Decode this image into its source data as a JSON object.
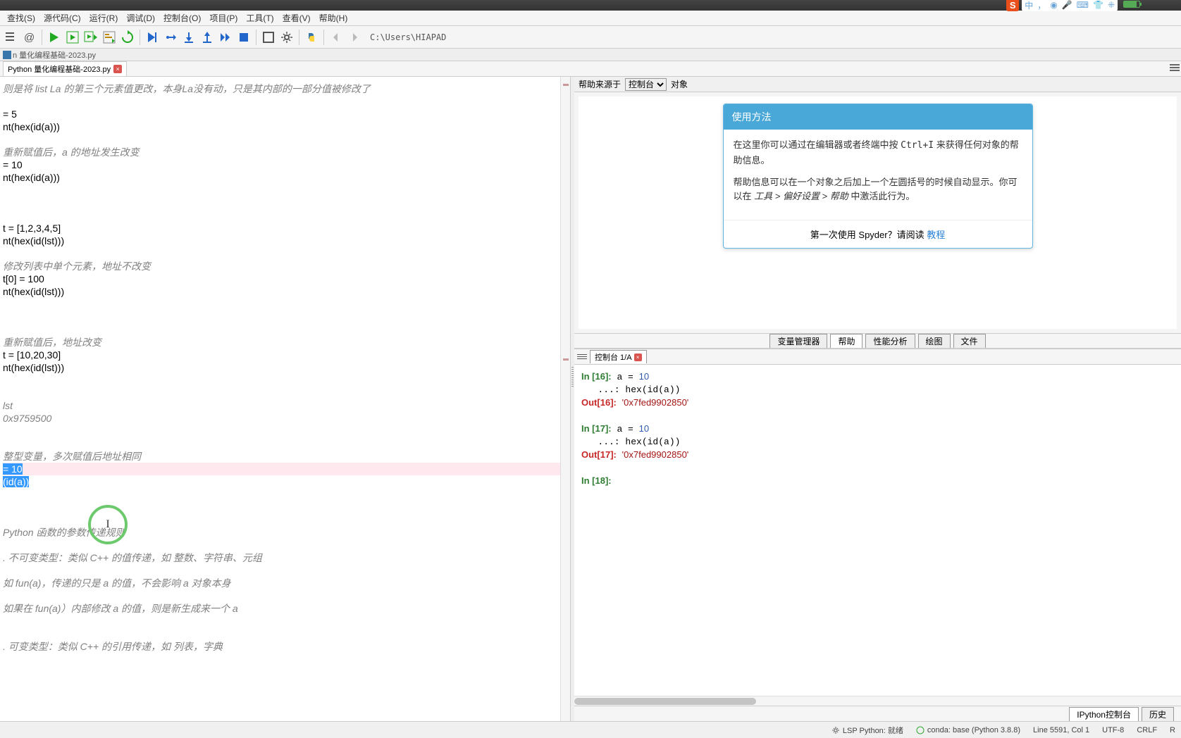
{
  "ime": {
    "logo": "S",
    "mode": "中",
    "punct": "，"
  },
  "menu": {
    "items": [
      "查找(S)",
      "源代码(C)",
      "运行(R)",
      "调试(D)",
      "控制台(O)",
      "项目(P)",
      "工具(T)",
      "查看(V)",
      "帮助(H)"
    ]
  },
  "toolbar": {
    "path": "C:\\Users\\HIAPAD"
  },
  "file_breadcrumb": "n 量化编程基础-2023.py",
  "editor_tab": {
    "label": "Python 量化编程基础-2023.py"
  },
  "code_lines": [
    {
      "cls": "comment",
      "text": "则是将 list La 的第三个元素值更改，本身La没有动，只是其内部的一部分值被修改了"
    },
    {
      "cls": "",
      "text": ""
    },
    {
      "cls": "",
      "text": "= 5"
    },
    {
      "cls": "",
      "text": "nt(hex(id(a)))"
    },
    {
      "cls": "",
      "text": ""
    },
    {
      "cls": "comment",
      "text": "重新赋值后，a 的地址发生改变"
    },
    {
      "cls": "",
      "text": "= 10"
    },
    {
      "cls": "",
      "text": "nt(hex(id(a)))"
    },
    {
      "cls": "",
      "text": ""
    },
    {
      "cls": "",
      "text": ""
    },
    {
      "cls": "",
      "text": ""
    },
    {
      "cls": "",
      "text": "t = [1,2,3,4,5]"
    },
    {
      "cls": "",
      "text": "nt(hex(id(lst)))"
    },
    {
      "cls": "",
      "text": ""
    },
    {
      "cls": "comment",
      "text": "修改列表中单个元素，地址不改变"
    },
    {
      "cls": "",
      "text": "t[0] = 100"
    },
    {
      "cls": "",
      "text": "nt(hex(id(lst)))"
    },
    {
      "cls": "",
      "text": ""
    },
    {
      "cls": "",
      "text": ""
    },
    {
      "cls": "",
      "text": ""
    },
    {
      "cls": "comment",
      "text": "重新赋值后，地址改变"
    },
    {
      "cls": "",
      "text": "t = [10,20,30]"
    },
    {
      "cls": "",
      "text": "nt(hex(id(lst)))"
    },
    {
      "cls": "",
      "text": ""
    },
    {
      "cls": "",
      "text": ""
    },
    {
      "cls": "comment",
      "text": "lst"
    },
    {
      "cls": "comment",
      "text": "0x9759500"
    },
    {
      "cls": "",
      "text": ""
    },
    {
      "cls": "",
      "text": ""
    },
    {
      "cls": "comment",
      "text": "整型变量，多次赋值后地址相同"
    },
    {
      "cls": "hl sel",
      "text": "= 10"
    },
    {
      "cls": "sel",
      "text": "(id(a))"
    },
    {
      "cls": "",
      "text": ""
    },
    {
      "cls": "",
      "text": ""
    },
    {
      "cls": "",
      "text": ""
    },
    {
      "cls": "comment",
      "text": "Python 函数的参数传递规则"
    },
    {
      "cls": "",
      "text": ""
    },
    {
      "cls": "comment",
      "text": ". 不可变类型：类似 C++ 的值传递，如 整数、字符串、元组"
    },
    {
      "cls": "",
      "text": ""
    },
    {
      "cls": "comment",
      "text": "如 fun(a)，传递的只是 a 的值，不会影响 a 对象本身"
    },
    {
      "cls": "",
      "text": ""
    },
    {
      "cls": "comment",
      "text": "如果在 fun(a)）内部修改 a 的值，则是新生成来一个 a"
    },
    {
      "cls": "",
      "text": ""
    },
    {
      "cls": "",
      "text": ""
    },
    {
      "cls": "comment",
      "text": ". 可变类型：类似 C++ 的引用传递，如 列表，字典"
    }
  ],
  "help_header": {
    "label_source": "帮助来源于",
    "dropdown": "控制台",
    "label_object": "对象"
  },
  "help_card": {
    "title": "使用方法",
    "p1a": "在这里你可以通过在编辑器或者终端中按 ",
    "p1kbd": "Ctrl+I",
    "p1b": " 来获得任何对象的帮助信息。",
    "p2a": "帮助信息可以在一个对象之后加上一个左圆括号的时候自动显示。你可以在 ",
    "p2path": "工具 > 偏好设置 > 帮助",
    "p2b": " 中激活此行为。",
    "footer_prefix": "第一次使用 Spyder？请阅读 ",
    "footer_link": "教程"
  },
  "tooltabs": [
    "变量管理器",
    "帮助",
    "性能分析",
    "绘图",
    "文件"
  ],
  "console_tab": "控制台 1/A",
  "console": {
    "lines": [
      {
        "t": "in",
        "n": "16",
        "code": "a = 10"
      },
      {
        "t": "cont",
        "code": "hex(id(a))"
      },
      {
        "t": "out",
        "n": "16",
        "val": "'0x7fed9902850'"
      },
      {
        "t": "blank"
      },
      {
        "t": "in",
        "n": "17",
        "code": "a = 10"
      },
      {
        "t": "cont",
        "code": "hex(id(a))"
      },
      {
        "t": "out",
        "n": "17",
        "val": "'0x7fed9902850'"
      },
      {
        "t": "blank"
      },
      {
        "t": "prompt",
        "n": "18"
      }
    ]
  },
  "bottom_tabs": [
    "IPython控制台",
    "历史"
  ],
  "statusbar": {
    "lsp": "LSP Python: 就绪",
    "conda": "conda: base (Python 3.8.8)",
    "pos": "Line 5591, Col 1",
    "enc": "UTF-8",
    "eol": "CRLF",
    "rw": "R"
  }
}
